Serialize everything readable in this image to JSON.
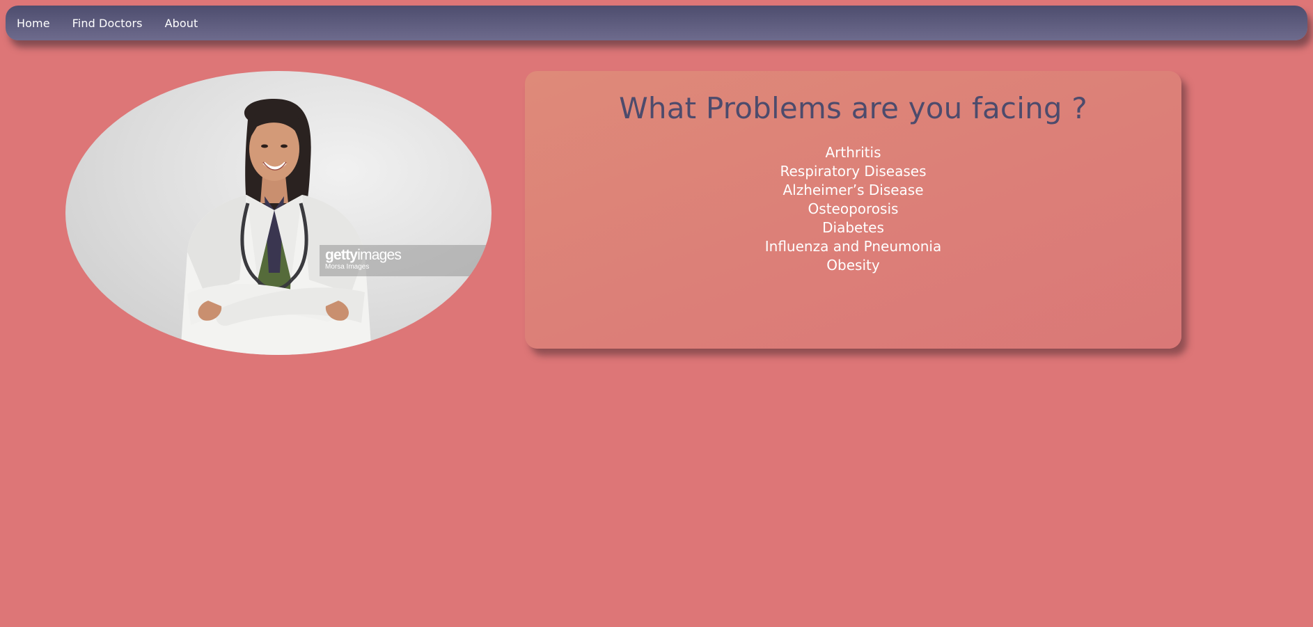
{
  "nav": {
    "items": [
      {
        "label": "Home"
      },
      {
        "label": "Find Doctors"
      },
      {
        "label": "About"
      }
    ]
  },
  "hero": {
    "watermark": {
      "brand_bold": "getty",
      "brand_light": "images",
      "credit": "Morsa Images"
    }
  },
  "problems": {
    "title": "What Problems are you facing ?",
    "items": [
      "Arthritis",
      "Respiratory Diseases",
      "Alzheimer’s Disease",
      "Osteoporosis",
      "Diabetes",
      "Influenza and Pneumonia",
      "Obesity"
    ]
  },
  "colors": {
    "background": "#dd7677",
    "nav_gradient_top": "#4d4d6e",
    "nav_gradient_bottom": "#6e6b8d",
    "card": "#dc8078",
    "title_text": "#4d4b6c",
    "list_text": "#ffffff"
  }
}
